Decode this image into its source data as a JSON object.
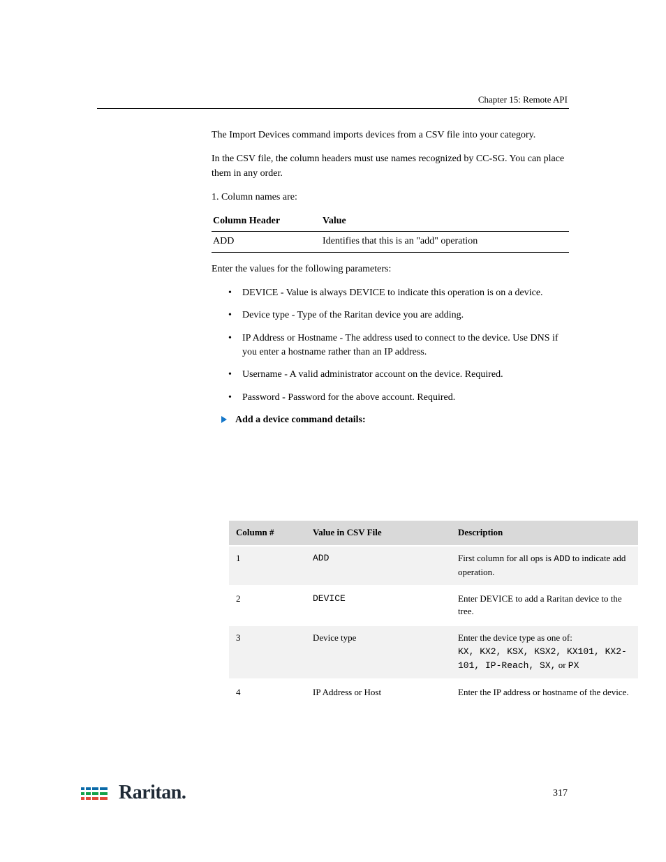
{
  "header": {
    "chapter": "Chapter 15: Remote API"
  },
  "body": {
    "intro1": "The Import Devices command imports devices from a CSV file into your category.",
    "intro2": "In the CSV file, the column headers must use names recognized by CC-SG. You can place them in any order.",
    "step": "1. Column names are:",
    "cols": {
      "l": "Column Header",
      "r": "Value",
      "rl": "ADD",
      "rr": "Identifies that this is an \"add\" operation"
    },
    "valintro": "Enter the values for the following parameters:",
    "bullets": [
      "DEVICE - Value is always DEVICE to indicate this operation is on a device.",
      "Device type - Type of the Raritan device you are adding.",
      "IP Address or Hostname - The address used to connect to the device. Use DNS if you enter a hostname rather than an IP address.",
      "Username - A valid administrator account on the device. Required.",
      "Password - Password for the above account. Required."
    ],
    "subhead": "Add a device command details:"
  },
  "cmd": {
    "head": [
      "Column #",
      "Value in CSV File",
      "Description"
    ],
    "rows": [
      {
        "c0": "1",
        "c1": "ADD",
        "c2a": "First column for all ops is",
        "c2b": "ADD",
        "c2c": "to indicate add operation."
      },
      {
        "c0": "2",
        "c1": "DEVICE",
        "c2": "Enter DEVICE to add a Raritan device to the tree."
      },
      {
        "c0": "3",
        "c1": "Device type",
        "c2a": "Enter the device type as one of:",
        "c2b": "KX, KX2, KSX, KSX2, KX101, KX2-101, IP-Reach, SX,",
        "c2c": "or",
        "c2d": "PX"
      },
      {
        "c0": "4",
        "c1": "IP Address or Host",
        "c2": "Enter the IP address or hostname of the device."
      }
    ]
  },
  "footer": {
    "brand": "Raritan.",
    "page": "317"
  }
}
